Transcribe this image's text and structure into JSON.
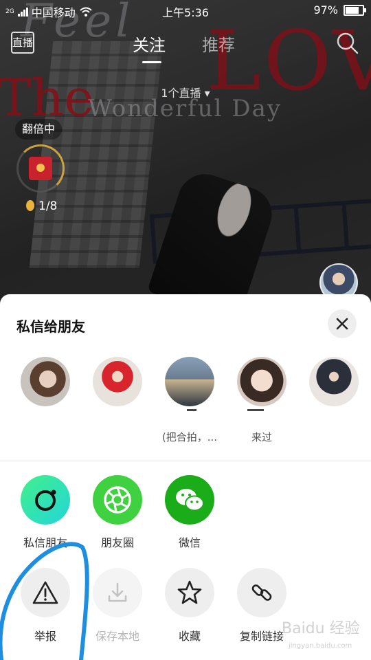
{
  "status_bar": {
    "network": "2G",
    "carrier": "中国移动",
    "time": "上午5:36",
    "battery": "97%",
    "battery_level": 0.97
  },
  "video_overlay": {
    "deco_text_1": "Feel",
    "deco_text_2": "LOV",
    "deco_text_3": "The",
    "deco_text_4": "Wonderful Day"
  },
  "top_nav": {
    "live_label": "直播",
    "tabs": [
      {
        "label": "关注",
        "active": true
      },
      {
        "label": "推荐",
        "active": false
      }
    ],
    "search_icon": "search-icon",
    "live_count": "1个直播 ▾"
  },
  "left_widgets": {
    "double_badge": "翻倍中",
    "coin_progress": "1/8"
  },
  "share_sheet": {
    "title": "私信给朋友",
    "close_icon": "close-icon",
    "friends": [
      {
        "name": ""
      },
      {
        "name": ""
      },
      {
        "name": "(把合拍，..."
      },
      {
        "name": "来过"
      },
      {
        "name": ""
      }
    ],
    "share_actions": [
      {
        "label": "私信朋友",
        "icon": "message-bubble-icon",
        "color": "#2fe0c0"
      },
      {
        "label": "朋友圈",
        "icon": "moments-aperture-icon",
        "color": "#3fd140"
      },
      {
        "label": "微信",
        "icon": "wechat-icon",
        "color": "#1aad19"
      }
    ],
    "tool_actions": [
      {
        "label": "举报",
        "icon": "warning-icon",
        "disabled": false
      },
      {
        "label": "保存本地",
        "icon": "download-icon",
        "disabled": true
      },
      {
        "label": "收藏",
        "icon": "star-icon",
        "disabled": false
      },
      {
        "label": "复制链接",
        "icon": "link-icon",
        "disabled": false
      }
    ]
  },
  "watermark": {
    "text": "Baidu 经验",
    "sub": "jingyan.baidu.com"
  },
  "colors": {
    "annotation_stroke": "#1e8fe0",
    "sheet_bg": "#ffffff",
    "icon_bg": "#eeeeee"
  }
}
